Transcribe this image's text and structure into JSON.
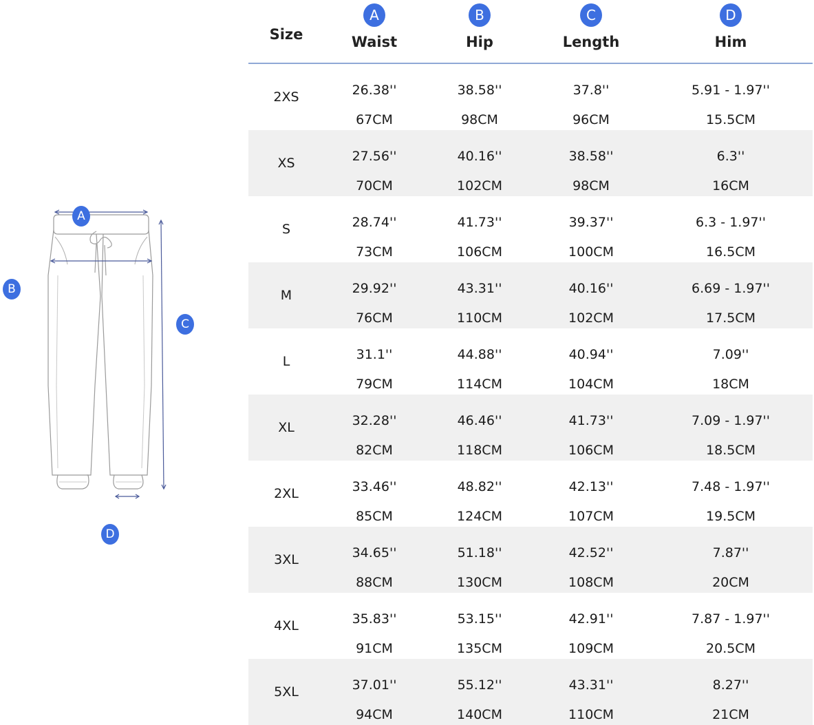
{
  "diagram": {
    "badges": {
      "a": "A",
      "b": "B",
      "c": "C",
      "d": "D"
    }
  },
  "table": {
    "size_header": "Size",
    "columns": [
      {
        "badge": "A",
        "label": "Waist"
      },
      {
        "badge": "B",
        "label": "Hip"
      },
      {
        "badge": "C",
        "label": "Length"
      },
      {
        "badge": "D",
        "label": "Him"
      }
    ],
    "rows": [
      {
        "size": "2XS",
        "waist_in": "26.38''",
        "waist_cm": "67CM",
        "hip_in": "38.58''",
        "hip_cm": "98CM",
        "length_in": "37.8''",
        "length_cm": "96CM",
        "him_in": "5.91 - 1.97''",
        "him_cm": "15.5CM"
      },
      {
        "size": "XS",
        "waist_in": "27.56''",
        "waist_cm": "70CM",
        "hip_in": "40.16''",
        "hip_cm": "102CM",
        "length_in": "38.58''",
        "length_cm": "98CM",
        "him_in": "6.3''",
        "him_cm": "16CM"
      },
      {
        "size": "S",
        "waist_in": "28.74''",
        "waist_cm": "73CM",
        "hip_in": "41.73''",
        "hip_cm": "106CM",
        "length_in": "39.37''",
        "length_cm": "100CM",
        "him_in": "6.3 - 1.97''",
        "him_cm": "16.5CM"
      },
      {
        "size": "M",
        "waist_in": "29.92''",
        "waist_cm": "76CM",
        "hip_in": "43.31''",
        "hip_cm": "110CM",
        "length_in": "40.16''",
        "length_cm": "102CM",
        "him_in": "6.69 - 1.97''",
        "him_cm": "17.5CM"
      },
      {
        "size": "L",
        "waist_in": "31.1''",
        "waist_cm": "79CM",
        "hip_in": "44.88''",
        "hip_cm": "114CM",
        "length_in": "40.94''",
        "length_cm": "104CM",
        "him_in": "7.09''",
        "him_cm": "18CM"
      },
      {
        "size": "XL",
        "waist_in": "32.28''",
        "waist_cm": "82CM",
        "hip_in": "46.46''",
        "hip_cm": "118CM",
        "length_in": "41.73''",
        "length_cm": "106CM",
        "him_in": "7.09 - 1.97''",
        "him_cm": "18.5CM"
      },
      {
        "size": "2XL",
        "waist_in": "33.46''",
        "waist_cm": "85CM",
        "hip_in": "48.82''",
        "hip_cm": "124CM",
        "length_in": "42.13''",
        "length_cm": "107CM",
        "him_in": "7.48 - 1.97''",
        "him_cm": "19.5CM"
      },
      {
        "size": "3XL",
        "waist_in": "34.65''",
        "waist_cm": "88CM",
        "hip_in": "51.18''",
        "hip_cm": "130CM",
        "length_in": "42.52''",
        "length_cm": "108CM",
        "him_in": "7.87''",
        "him_cm": "20CM"
      },
      {
        "size": "4XL",
        "waist_in": "35.83''",
        "waist_cm": "91CM",
        "hip_in": "53.15''",
        "hip_cm": "135CM",
        "length_in": "42.91''",
        "length_cm": "109CM",
        "him_in": "7.87 - 1.97''",
        "him_cm": "20.5CM"
      },
      {
        "size": "5XL",
        "waist_in": "37.01''",
        "waist_cm": "94CM",
        "hip_in": "55.12''",
        "hip_cm": "140CM",
        "length_in": "43.31''",
        "length_cm": "110CM",
        "him_in": "8.27''",
        "him_cm": "21CM"
      }
    ]
  },
  "colors": {
    "badge": "#3d6fe0",
    "header_rule": "#8fa8d6",
    "row_shade": "#f0f0f0",
    "measure_line": "#4a5a9a"
  }
}
